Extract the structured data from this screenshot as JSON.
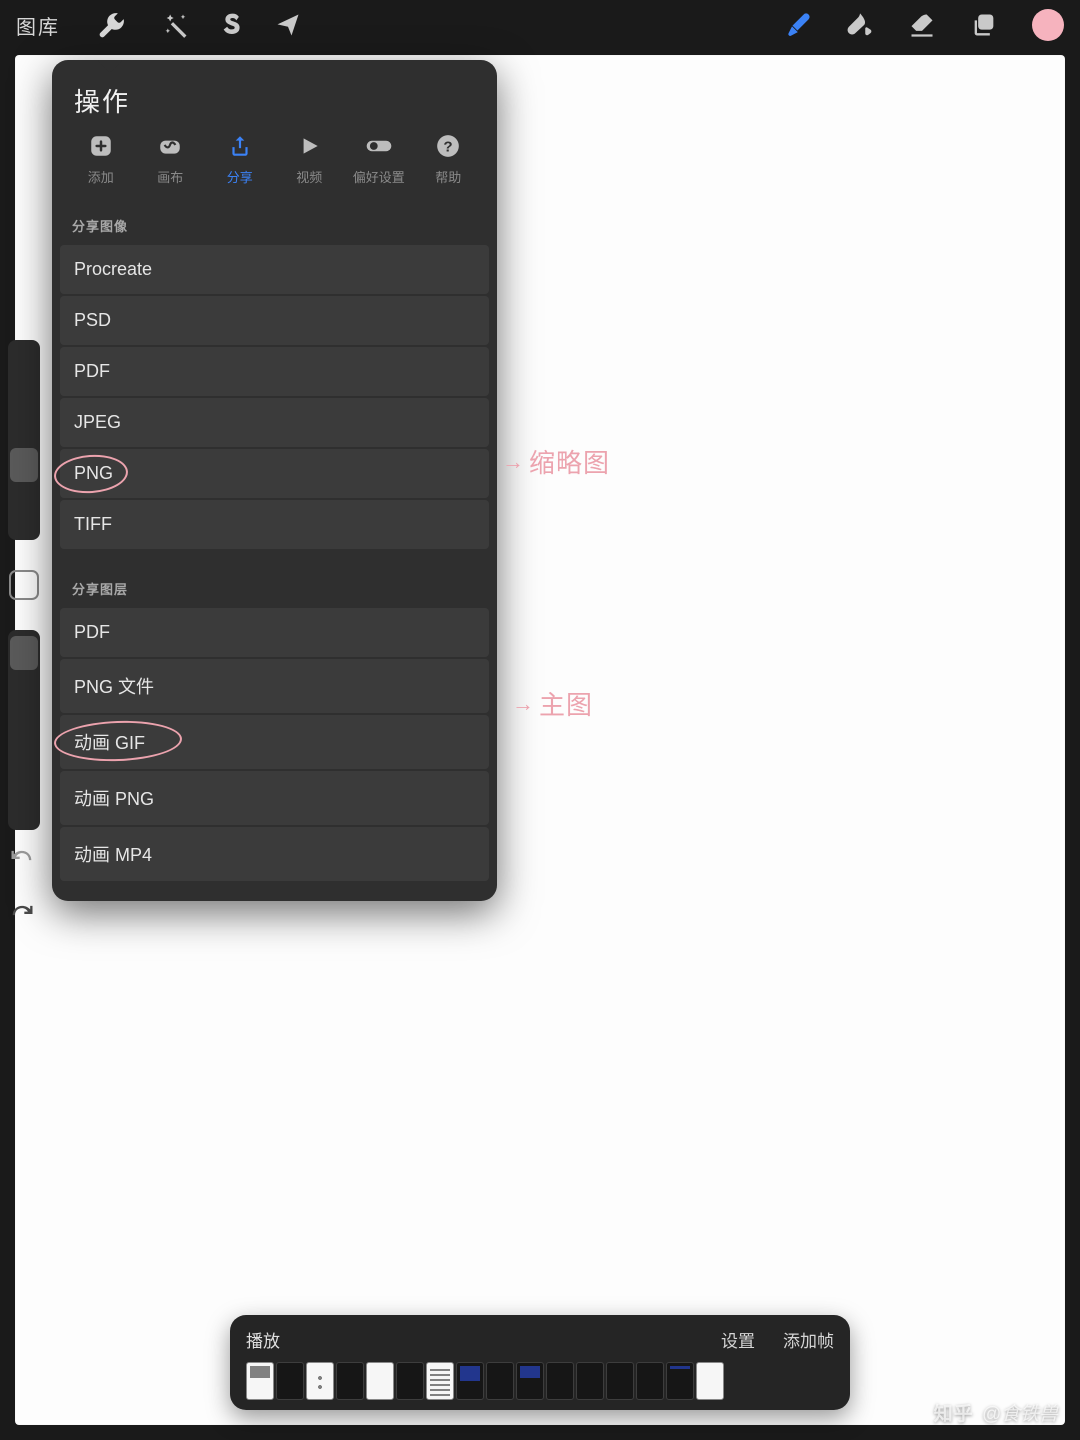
{
  "topbar": {
    "gallery_label": "图库"
  },
  "popover": {
    "title": "操作",
    "tabs": [
      {
        "label": "添加",
        "icon": "add"
      },
      {
        "label": "画布",
        "icon": "canvas"
      },
      {
        "label": "分享",
        "icon": "share",
        "active": true
      },
      {
        "label": "视频",
        "icon": "video"
      },
      {
        "label": "偏好设置",
        "icon": "prefs"
      },
      {
        "label": "帮助",
        "icon": "help"
      }
    ],
    "section1_title": "分享图像",
    "section1_items": [
      "Procreate",
      "PSD",
      "PDF",
      "JPEG",
      "PNG",
      "TIFF"
    ],
    "section2_title": "分享图层",
    "section2_items": [
      "PDF",
      "PNG 文件",
      "动画 GIF",
      "动画 PNG",
      "动画 MP4"
    ]
  },
  "annotations": {
    "png_note": "缩略图",
    "gif_note": "主图",
    "arrow": "→"
  },
  "timeline": {
    "play_label": "播放",
    "settings_label": "设置",
    "add_frame_label": "添加帧",
    "frame_count": 16
  },
  "watermark": {
    "brand": "知乎",
    "user": "@食铁兽"
  },
  "colors": {
    "accent": "#3b82f6",
    "brush_color": "#f6b3be",
    "annotation": "#eca3ae"
  }
}
